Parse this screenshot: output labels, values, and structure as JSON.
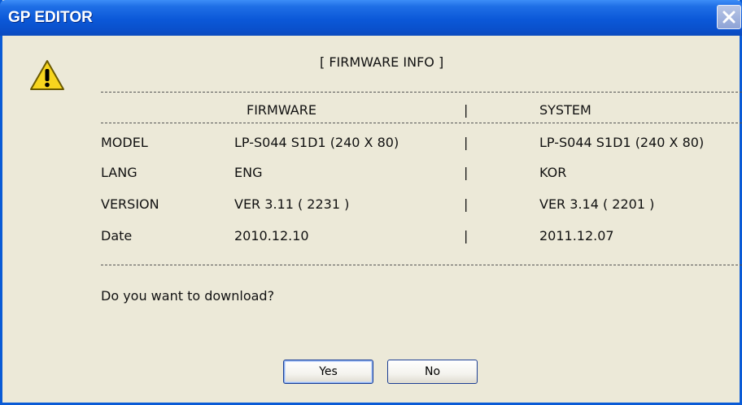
{
  "window": {
    "title": "GP EDITOR"
  },
  "heading": "[ FIRMWARE INFO ]",
  "table": {
    "headers": [
      "FIRMWARE",
      "|",
      "SYSTEM"
    ],
    "rows": [
      {
        "label": "MODEL",
        "firmware": "LP-S044  S1D1  (240 X 80)",
        "sep": "|",
        "system": "LP-S044  S1D1  (240 X 80)"
      },
      {
        "label": "LANG",
        "firmware": "ENG",
        "sep": "|",
        "system": "KOR"
      },
      {
        "label": "VERSION",
        "firmware": "VER 3.11 ( 2231 )",
        "sep": "|",
        "system": "VER 3.14 ( 2201 )"
      },
      {
        "label": "Date",
        "firmware": "2010.12.10",
        "sep": "|",
        "system": "2011.12.07"
      }
    ]
  },
  "question": "Do you want to download?",
  "buttons": {
    "yes": "Yes",
    "no": "No"
  },
  "icons": {
    "close": "close-icon",
    "warning": "warning-icon"
  },
  "colors": {
    "titlebar": "#0b58d8",
    "dialog_bg": "#ece9d8",
    "warning": "#f7d51e"
  }
}
